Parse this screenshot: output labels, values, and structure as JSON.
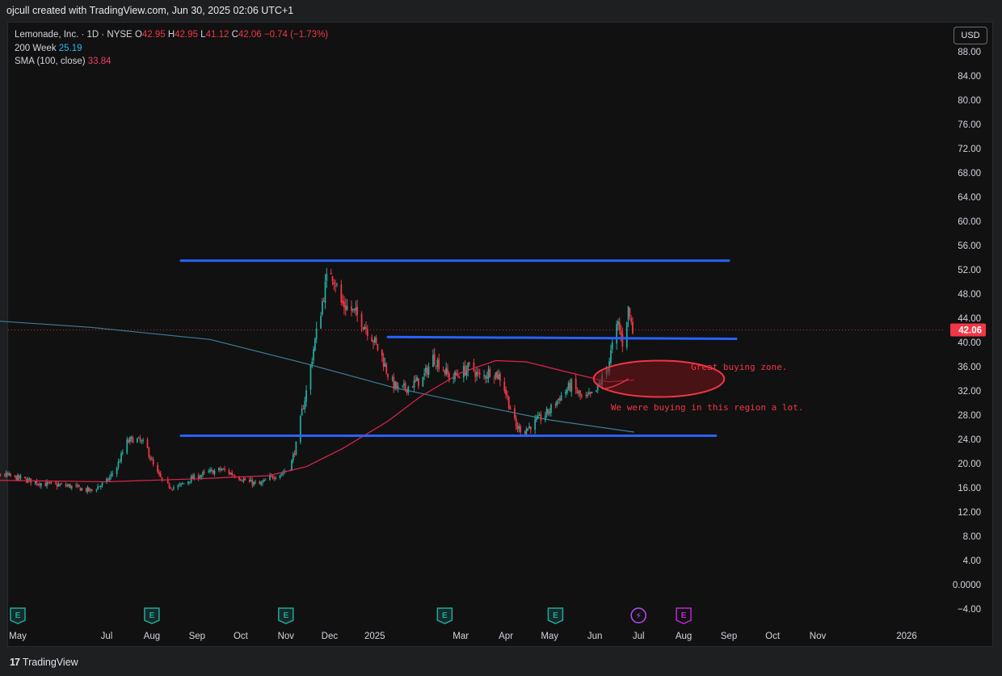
{
  "header": {
    "creator_line": "ojcull created with TradingView.com, Jun 30, 2025 02:06 UTC+1"
  },
  "legend": {
    "symbol": "Lemonade, Inc. · 1D · NYSE",
    "o_label": "O",
    "o_value": "42.95",
    "h_label": "H",
    "h_value": "42.95",
    "l_label": "L",
    "l_value": "41.12",
    "c_label": "C",
    "c_value": "42.06",
    "change": "−0.74 (−1.73%)",
    "ma1_name": "200 Week",
    "ma1_value": "25.19",
    "ma2_name": "SMA (100, close)",
    "ma2_value": "33.84"
  },
  "toolbar": {
    "currency": "USD"
  },
  "footer": {
    "logo_mark": "17",
    "brand": "TradingView"
  },
  "colors": {
    "up": "#26a69a",
    "down": "#f23645",
    "ma_week": "#3d7e99",
    "sma": "#e0244e",
    "trendline": "#2962ff",
    "annotation": "#f23645",
    "price_badge": "#f23645",
    "background": "#111111"
  },
  "chart_data": {
    "type": "candlestick",
    "title": "Lemonade, Inc. · 1D · NYSE",
    "ylim": [
      -4,
      88
    ],
    "y_ticks": [
      "88.00",
      "84.00",
      "80.00",
      "76.00",
      "72.00",
      "68.00",
      "64.00",
      "60.00",
      "56.00",
      "52.00",
      "48.00",
      "44.00",
      "40.00",
      "36.00",
      "32.00",
      "28.00",
      "24.00",
      "20.00",
      "16.00",
      "12.00",
      "8.00",
      "4.00",
      "0.0000",
      "−4.00"
    ],
    "x_ticks": [
      "May",
      "Jul",
      "Aug",
      "Sep",
      "Oct",
      "Nov",
      "Dec",
      "2025",
      "Mar",
      "Apr",
      "May",
      "Jun",
      "Jul",
      "Aug",
      "Sep",
      "Oct",
      "Nov",
      "2026"
    ],
    "x_tick_dates": [
      "2024-05-01",
      "2024-07-01",
      "2024-08-01",
      "2024-09-01",
      "2024-10-01",
      "2024-11-01",
      "2024-12-01",
      "2025-01-01",
      "2025-03-01",
      "2025-04-01",
      "2025-05-01",
      "2025-06-01",
      "2025-07-01",
      "2025-08-01",
      "2025-09-01",
      "2025-10-01",
      "2025-11-01",
      "2026-01-01"
    ],
    "last_price": {
      "value": 42.06,
      "label": "42.06"
    },
    "price_path": [
      [
        "2024-04-01",
        17.5
      ],
      [
        "2024-04-20",
        18.2
      ],
      [
        "2024-05-05",
        17.4
      ],
      [
        "2024-05-20",
        16.6
      ],
      [
        "2024-06-05",
        16.3
      ],
      [
        "2024-06-20",
        15.5
      ],
      [
        "2024-07-01",
        17.0
      ],
      [
        "2024-07-08",
        19.5
      ],
      [
        "2024-07-15",
        23.5
      ],
      [
        "2024-07-20",
        24.2
      ],
      [
        "2024-07-28",
        23.0
      ],
      [
        "2024-08-03",
        19.0
      ],
      [
        "2024-08-10",
        16.5
      ],
      [
        "2024-08-18",
        16.0
      ],
      [
        "2024-08-28",
        17.5
      ],
      [
        "2024-09-08",
        18.5
      ],
      [
        "2024-09-18",
        19.0
      ],
      [
        "2024-09-28",
        18.0
      ],
      [
        "2024-10-06",
        17.0
      ],
      [
        "2024-10-14",
        16.5
      ],
      [
        "2024-10-22",
        17.8
      ],
      [
        "2024-10-30",
        18.5
      ],
      [
        "2024-11-04",
        19.5
      ],
      [
        "2024-11-08",
        23.0
      ],
      [
        "2024-11-12",
        28.5
      ],
      [
        "2024-11-16",
        33.0
      ],
      [
        "2024-11-20",
        39.0
      ],
      [
        "2024-11-24",
        44.0
      ],
      [
        "2024-11-27",
        48.0
      ],
      [
        "2024-12-01",
        52.5
      ],
      [
        "2024-12-05",
        50.0
      ],
      [
        "2024-12-09",
        46.5
      ],
      [
        "2024-12-15",
        45.5
      ],
      [
        "2024-12-22",
        44.0
      ],
      [
        "2024-12-30",
        41.0
      ],
      [
        "2025-01-06",
        37.5
      ],
      [
        "2025-01-12",
        33.5
      ],
      [
        "2025-01-18",
        32.0
      ],
      [
        "2025-01-26",
        33.0
      ],
      [
        "2025-02-03",
        34.0
      ],
      [
        "2025-02-10",
        37.5
      ],
      [
        "2025-02-16",
        36.0
      ],
      [
        "2025-02-22",
        34.0
      ],
      [
        "2025-03-01",
        35.0
      ],
      [
        "2025-03-08",
        36.0
      ],
      [
        "2025-03-15",
        34.0
      ],
      [
        "2025-03-22",
        35.5
      ],
      [
        "2025-03-29",
        34.0
      ],
      [
        "2025-04-03",
        30.0
      ],
      [
        "2025-04-08",
        26.0
      ],
      [
        "2025-04-14",
        25.5
      ],
      [
        "2025-04-22",
        27.0
      ],
      [
        "2025-04-30",
        28.5
      ],
      [
        "2025-05-08",
        31.0
      ],
      [
        "2025-05-16",
        33.0
      ],
      [
        "2025-05-24",
        30.5
      ],
      [
        "2025-06-01",
        31.5
      ],
      [
        "2025-06-06",
        34.0
      ],
      [
        "2025-06-10",
        36.0
      ],
      [
        "2025-06-14",
        40.5
      ],
      [
        "2025-06-17",
        43.0
      ],
      [
        "2025-06-20",
        40.0
      ],
      [
        "2025-06-24",
        45.5
      ],
      [
        "2025-06-27",
        42.0
      ]
    ],
    "series": [
      {
        "name": "200 Week",
        "values": [
          [
            -0.0,
            43.8
          ],
          [
            0.13,
            42.5
          ],
          [
            0.25,
            40.5
          ],
          [
            0.34,
            36.5
          ],
          [
            0.45,
            32.5
          ],
          [
            0.55,
            29.5
          ],
          [
            0.68,
            27.2
          ],
          [
            0.78,
            25.2
          ]
        ],
        "x": [
          "2024-04-01",
          "2024-06-20",
          "2024-09-10",
          "2024-11-15",
          "2025-01-15",
          "2025-03-15",
          "2025-05-01",
          "2025-06-28"
        ],
        "y": [
          43.8,
          42.5,
          40.5,
          36.5,
          32.5,
          29.5,
          27.2,
          25.2
        ]
      },
      {
        "name": "SMA (100, close)",
        "x": [
          "2024-04-01",
          "2024-07-01",
          "2024-09-01",
          "2024-10-20",
          "2024-11-15",
          "2024-12-10",
          "2025-01-10",
          "2025-02-01",
          "2025-03-01",
          "2025-03-25",
          "2025-04-15",
          "2025-05-15",
          "2025-06-10",
          "2025-06-28"
        ],
        "y": [
          17.3,
          17.0,
          17.5,
          18.0,
          19.5,
          22.5,
          27.0,
          31.0,
          35.0,
          37.0,
          36.8,
          35.0,
          33.5,
          33.8
        ]
      }
    ],
    "drawings": {
      "trendlines": [
        {
          "x1": "2024-08-21",
          "x2": "2025-09-01",
          "y": 53.5
        },
        {
          "x1": "2025-01-10",
          "x2": "2025-09-06",
          "y1": 40.9,
          "y2": 40.6
        },
        {
          "x1": "2024-08-21",
          "x2": "2025-08-23",
          "y": 24.6
        }
      ],
      "ellipse": {
        "cx": "2025-07-15",
        "cy": 34.0,
        "rx_days": 16,
        "ry": 3.0
      },
      "arrow": {
        "x1": "2025-06-06",
        "y1": 32.3,
        "x2": "2025-06-24",
        "y2": 34.0
      },
      "annotations": [
        {
          "text": "Great buying zone.",
          "x": "2025-08-06",
          "y": 35.5
        },
        {
          "text": "We were buying in this region a lot.",
          "x": "2025-06-12",
          "y": 28.8
        }
      ]
    },
    "events": [
      {
        "x": "2024-05-01",
        "kind": "earnings",
        "label": "E"
      },
      {
        "x": "2024-08-01",
        "kind": "earnings",
        "label": "E"
      },
      {
        "x": "2024-11-01",
        "kind": "earnings",
        "label": "E"
      },
      {
        "x": "2025-02-18",
        "kind": "earnings",
        "label": "E"
      },
      {
        "x": "2025-05-05",
        "kind": "earnings",
        "label": "E"
      },
      {
        "x": "2025-07-01",
        "kind": "split",
        "label": "⚡"
      },
      {
        "x": "2025-08-01",
        "kind": "earnings-upcoming",
        "label": "E"
      }
    ]
  }
}
